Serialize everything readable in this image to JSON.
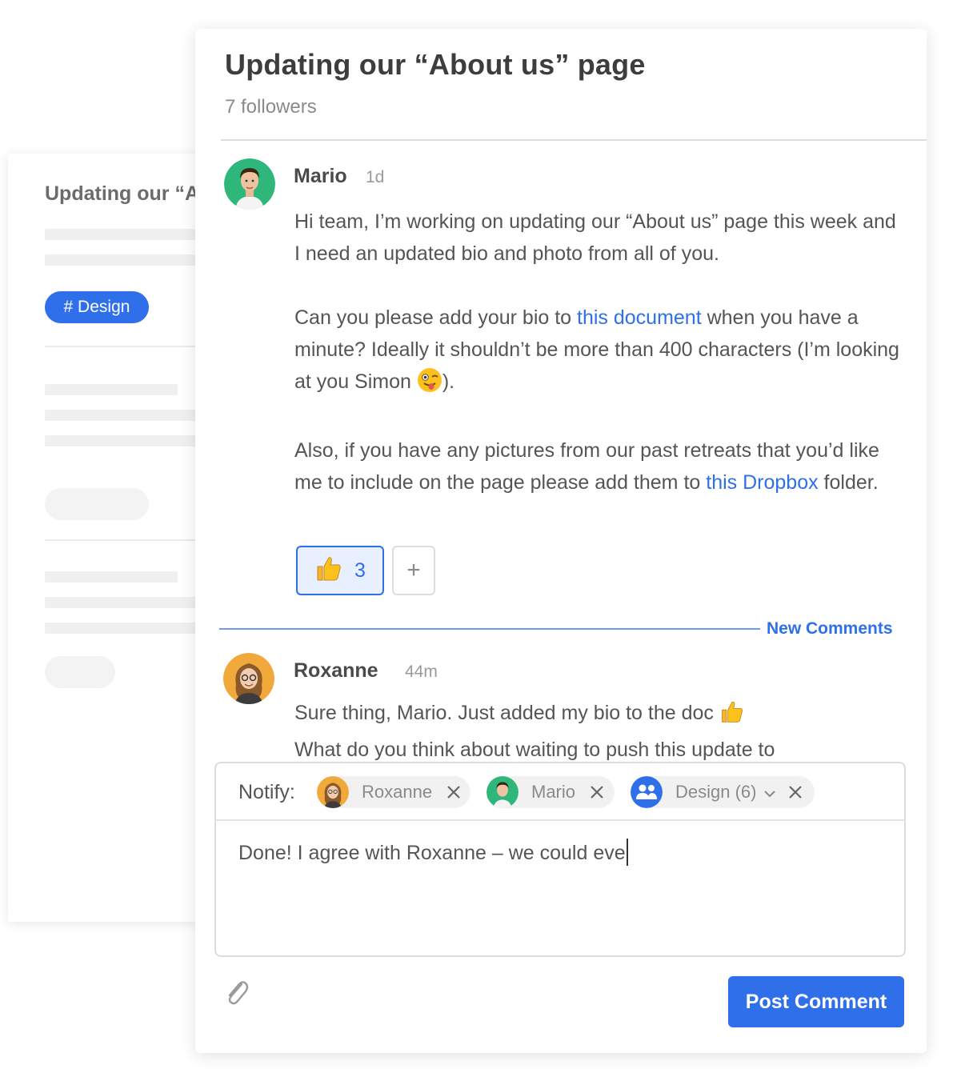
{
  "background_card": {
    "title": "Updating our “A",
    "tag": "# Design"
  },
  "thread": {
    "title": "Updating our “About us” page",
    "followers": "7 followers"
  },
  "post": {
    "author": "Mario",
    "time": "1d",
    "p1": "Hi team, I’m working on updating our “About us” page this week and I need an updated bio and photo from all of you.",
    "p2_before": "Can you please add your bio to ",
    "p2_link": "this document",
    "p2_after": " when you have a minute? Ideally it shouldn’t be more than 400 characters (I’m looking at you Simon ",
    "p2_end": ").",
    "p3_before": "Also, if you have any pictures from our past retreats that you’d like me to include on the page please add them to ",
    "p3_link": "this Dropbox",
    "p3_after": " folder.",
    "reaction_count": "3",
    "add_reaction": "+"
  },
  "new_comments_label": "New Comments",
  "comment": {
    "author": "Roxanne",
    "time": "44m",
    "line1": "Sure thing, Mario. Just added my bio to the doc ",
    "line2": "What do you think about waiting to push this update to"
  },
  "composer": {
    "notify_label": "Notify:",
    "chips": [
      {
        "label": "Roxanne"
      },
      {
        "label": "Mario"
      },
      {
        "label": "Design (6)"
      }
    ],
    "text": "Done! I agree with Roxanne – we could eve"
  },
  "post_button": "Post Comment",
  "colors": {
    "accent": "#2f6fea",
    "mario_avatar_bg": "#2fb67a",
    "roxanne_avatar_bg": "#f2a93b"
  }
}
